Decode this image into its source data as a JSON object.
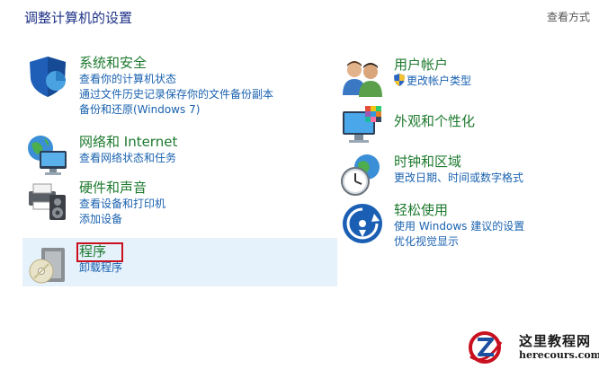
{
  "header": {
    "title": "调整计算机的设置",
    "view_by": "查看方式"
  },
  "left_categories": [
    {
      "title": "系统和安全",
      "icon": "security-shield-icon",
      "links": [
        "查看你的计算机状态",
        "通过文件历史记录保存你的文件备份副本",
        "备份和还原(Windows 7)"
      ]
    },
    {
      "title": "网络和 Internet",
      "icon": "network-globe-icon",
      "links": [
        "查看网络状态和任务"
      ]
    },
    {
      "title": "硬件和声音",
      "icon": "printer-speaker-icon",
      "links": [
        "查看设备和打印机",
        "添加设备"
      ]
    },
    {
      "title": "程序",
      "icon": "programs-disc-icon",
      "links": [
        "卸载程序"
      ]
    }
  ],
  "right_categories": [
    {
      "title": "用户帐户",
      "icon": "users-icon",
      "links": [
        "更改帐户类型"
      ]
    },
    {
      "title": "外观和个性化",
      "icon": "monitor-palette-icon",
      "links": []
    },
    {
      "title": "时钟和区域",
      "icon": "clock-globe-icon",
      "links": [
        "更改日期、时间或数字格式"
      ]
    },
    {
      "title": "轻松使用",
      "icon": "ease-of-access-icon",
      "links": [
        "使用 Windows 建议的设置",
        "优化视觉显示"
      ]
    }
  ],
  "watermark": {
    "name": "这里教程网",
    "url": "herecours.com"
  },
  "colors": {
    "title_green": "#1d7a2e",
    "link_blue": "#1a62b0",
    "hover_bg": "#e5f1fb",
    "highlight_red": "#c8101e",
    "header_blue": "#1e3287"
  }
}
